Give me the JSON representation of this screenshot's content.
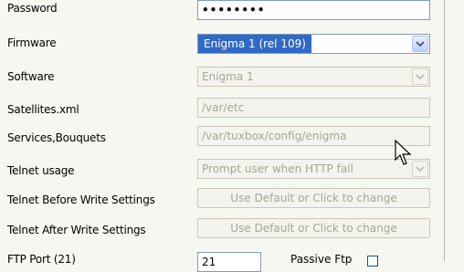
{
  "form": {
    "password": {
      "label": "Password",
      "value": "••••••••"
    },
    "firmware": {
      "label": "Firmware",
      "value": "Enigma 1 (rel 109)"
    },
    "software": {
      "label": "Software",
      "value": "Enigma 1"
    },
    "satellites": {
      "label": "Satellites.xml",
      "value": "/var/etc"
    },
    "services": {
      "label": "Services,Bouquets",
      "value": "/var/tuxbox/config/enigma"
    },
    "telnet_usage": {
      "label": "Telnet usage",
      "value": "Prompt user when HTTP fail"
    },
    "telnet_before": {
      "label": "Telnet Before Write Settings",
      "value": "Use Default or Click to change"
    },
    "telnet_after": {
      "label": "Telnet After Write Settings",
      "value": "Use Default or Click to change"
    },
    "ftp_port": {
      "label": "FTP Port (21)",
      "value": "21"
    },
    "passive_ftp": {
      "label": "Passive Ftp"
    }
  },
  "icons": {
    "dropdown": "chevron-down-icon",
    "cursor": "mouse-pointer-icon"
  }
}
